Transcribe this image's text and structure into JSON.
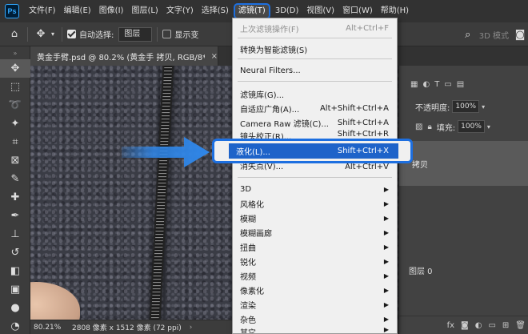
{
  "menubar": {
    "logo": "Ps",
    "items": [
      {
        "label": "文件(F)"
      },
      {
        "label": "编辑(E)"
      },
      {
        "label": "图像(I)"
      },
      {
        "label": "图层(L)"
      },
      {
        "label": "文字(Y)"
      },
      {
        "label": "选择(S)"
      },
      {
        "label": "滤镜(T)",
        "active": true
      },
      {
        "label": "3D(D)"
      },
      {
        "label": "视图(V)"
      },
      {
        "label": "窗口(W)"
      },
      {
        "label": "帮助(H)"
      }
    ]
  },
  "options": {
    "auto_select_label": "自动选择:",
    "auto_select_value": "图层",
    "show_transform_label": "显示变",
    "mode_label": "3D 模式"
  },
  "document": {
    "tab_title": "黄金手臂.psd @ 80.2% (黄金手 拷贝, RGB/8*) *",
    "close": "×"
  },
  "status": {
    "zoom": "80.21%",
    "info": "2808 像素 x 1512 像素 (72 ppi)",
    "arrow": "›"
  },
  "layers_panel": {
    "opacity_label": "不透明度:",
    "opacity_value": "100%",
    "fill_label": "填充:",
    "fill_value": "100%",
    "layer_name": "拷贝",
    "bg_layer_name": "图层 0"
  },
  "filter_menu": {
    "items": [
      {
        "label": "上次滤镜操作(F)",
        "shortcut": "Alt+Ctrl+F",
        "disabled": true
      },
      {
        "label": "转换为智能滤镜(S)",
        "shortcut": ""
      },
      {
        "label": "Neural Filters...",
        "shortcut": ""
      },
      {
        "label": "滤镜库(G)...",
        "shortcut": ""
      },
      {
        "label": "自适应广角(A)...",
        "shortcut": "Alt+Shift+Ctrl+A"
      },
      {
        "label": "Camera Raw 滤镜(C)...",
        "shortcut": "Shift+Ctrl+A"
      },
      {
        "label": "镜头校正(R)...",
        "shortcut": "Shift+Ctrl+R"
      },
      {
        "label": "液化(L)...",
        "shortcut": "Shift+Ctrl+X",
        "highlighted": true
      },
      {
        "label": "消失点(V)...",
        "shortcut": "Alt+Ctrl+V"
      },
      {
        "label": "3D",
        "submenu": true
      },
      {
        "label": "风格化",
        "submenu": true
      },
      {
        "label": "模糊",
        "submenu": true
      },
      {
        "label": "模糊画廊",
        "submenu": true
      },
      {
        "label": "扭曲",
        "submenu": true
      },
      {
        "label": "锐化",
        "submenu": true
      },
      {
        "label": "视频",
        "submenu": true
      },
      {
        "label": "像素化",
        "submenu": true
      },
      {
        "label": "渲染",
        "submenu": true
      },
      {
        "label": "杂色",
        "submenu": true
      },
      {
        "label": "其它",
        "submenu": true
      }
    ],
    "submenu_arrow": "▶"
  },
  "colors": {
    "accent_blue": "#1d6fe0",
    "highlight_blue": "#1e63c9",
    "arrow_blue": "#2f86e8"
  }
}
